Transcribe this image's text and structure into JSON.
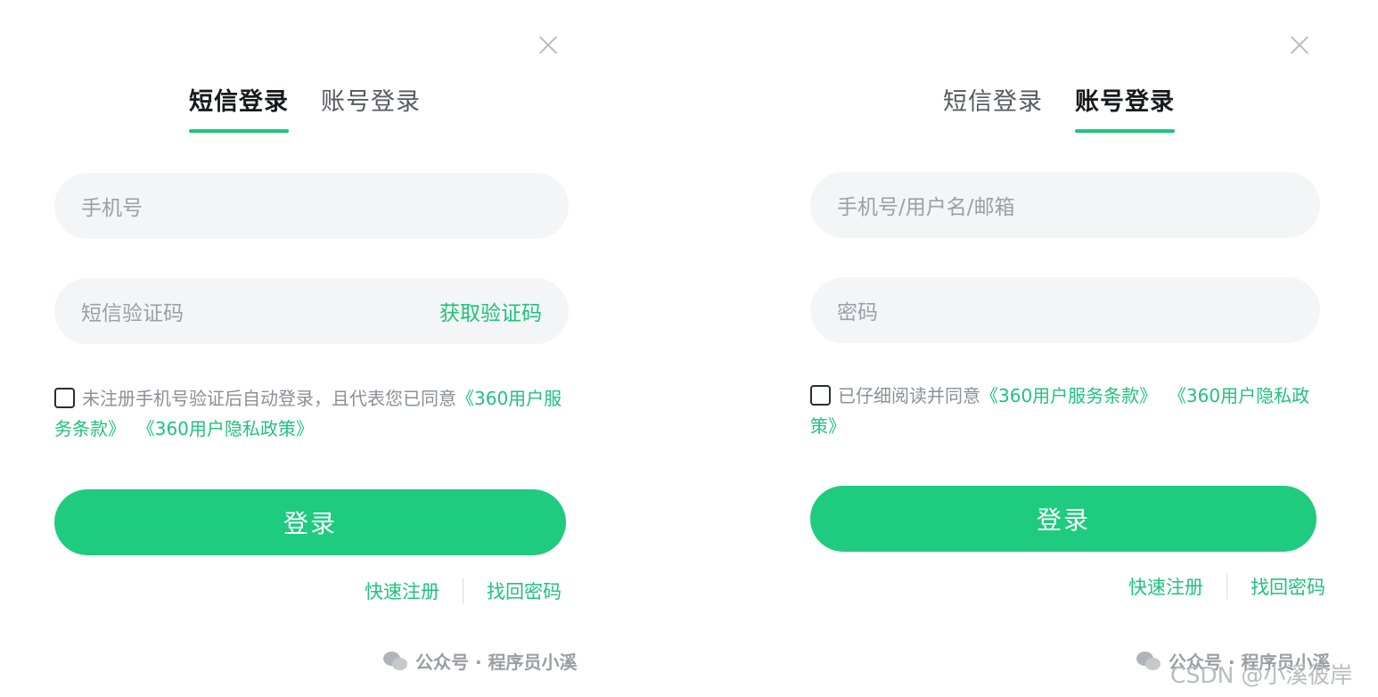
{
  "sms_panel": {
    "tabs": [
      "短信登录",
      "账号登录"
    ],
    "active_tab": 0,
    "phone_placeholder": "手机号",
    "code_placeholder": "短信验证码",
    "get_code": "获取验证码",
    "agree_text": "未注册手机号验证后自动登录，且代表您已同意",
    "agree_link_1": "《360用户服务条款》",
    "agree_link_2": "《360用户隐私政策》",
    "login": "登录",
    "register": "快速注册",
    "forgot": "找回密码",
    "watermark": "公众号 · 程序员小溪"
  },
  "account_panel": {
    "tabs": [
      "短信登录",
      "账号登录"
    ],
    "active_tab": 1,
    "user_placeholder": "手机号/用户名/邮箱",
    "password_placeholder": "密码",
    "agree_text": "已仔细阅读并同意",
    "agree_link_1": "《360用户服务条款》",
    "agree_link_2": "《360用户隐私政策》",
    "login": "登录",
    "register": "快速注册",
    "forgot": "找回密码",
    "watermark": "公众号 · 程序员小溪"
  },
  "csdn_watermark": "CSDN @小溪彼岸",
  "colors": {
    "accent": "#20c27c",
    "button": "#1fcb7f"
  }
}
